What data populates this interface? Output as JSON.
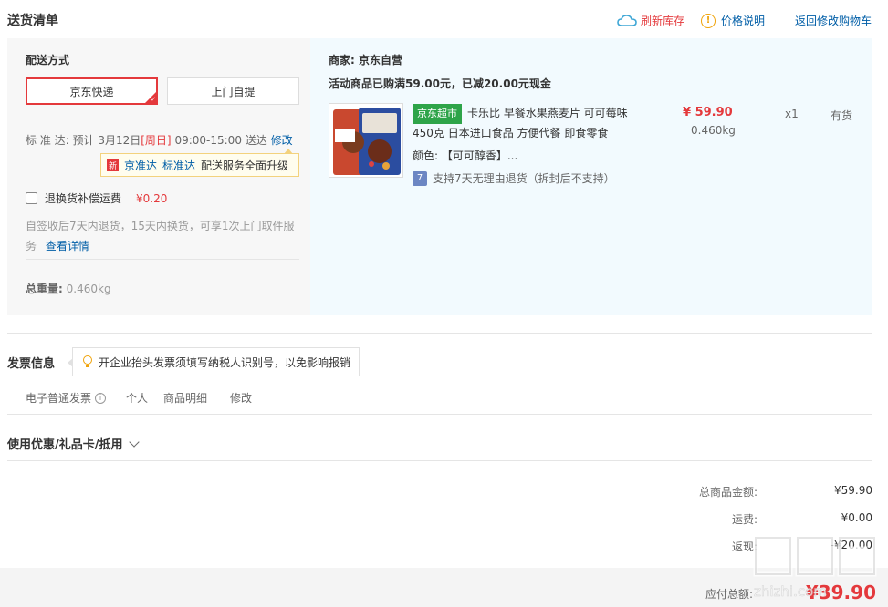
{
  "header": {
    "title": "送货清单",
    "refresh_label": "刷新库存",
    "price_note_label": "价格说明",
    "back_cart_label": "返回修改购物车"
  },
  "shipping": {
    "label": "配送方式",
    "options": [
      "京东快递",
      "上门自提"
    ],
    "selected": "京东快递",
    "std_prefix": "标 准 达:",
    "std_time_1": "预计 3月12日",
    "std_weekday": "[周日]",
    "std_time_2": "09:00-15:00 送达",
    "modify": "修改",
    "upgrade_badge": "新",
    "upgrade_items": [
      "京准达",
      "标准达"
    ],
    "upgrade_text": "配送服务全面升级",
    "return_insurance_label": "退换货补偿运费",
    "return_insurance_price": "¥0.20",
    "return_note": "自签收后7天内退货，15天内换货，可享1次上门取件服务",
    "return_note_link": "查看详情",
    "weight_label": "总重量:",
    "weight_value": "0.460kg"
  },
  "order": {
    "merchant": "商家:  京东自营",
    "promo": "活动商品已购满59.00元，已减20.00元现金",
    "product": {
      "tag": "京东超市",
      "name": "卡乐比 早餐水果燕麦片 可可莓味450克 日本进口食品 方便代餐 即食零食",
      "color": "颜色: 【可可醇香】...",
      "return_policy": "支持7天无理由退货（拆封后不支持）",
      "return_icon": "7",
      "price": "¥ 59.90",
      "weight": "0.460kg",
      "qty": "x1",
      "stock": "有货"
    }
  },
  "invoice": {
    "title": "发票信息",
    "tip": "开企业抬头发票须填写纳税人识别号，以免影响报销",
    "type": "电子普通发票",
    "info_icon": "i",
    "title_type": "个人",
    "content": "商品明细",
    "modify": "修改"
  },
  "coupon": {
    "label": "使用优惠/礼品卡/抵用"
  },
  "summary": {
    "goods_total_label": "总商品金额:",
    "goods_total": "¥59.90",
    "shipping_label": "运费:",
    "shipping": "¥0.00",
    "rebate_label": "返现:",
    "rebate": "-¥20.00",
    "payable_label": "应付总额:",
    "payable": "¥39.90"
  },
  "watermark": {
    "text": "zhizhi.com"
  },
  "colors": {
    "accent_red": "#e4393c",
    "link_blue": "#005ea7",
    "jd_green": "#2ea449",
    "panel_blue": "#f2fafe",
    "panel_grey": "#f7f7f7"
  }
}
